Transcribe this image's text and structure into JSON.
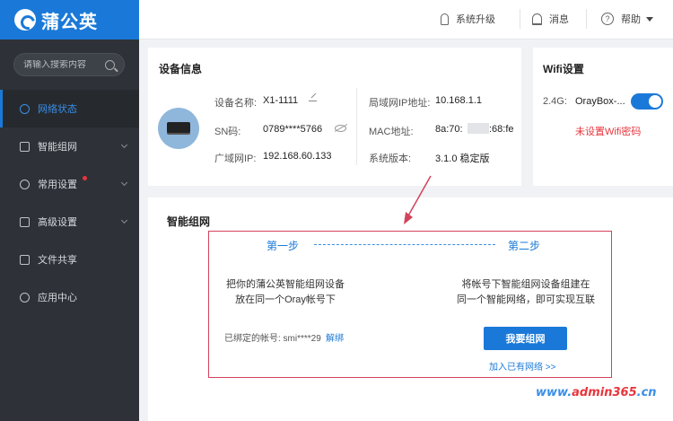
{
  "app": {
    "name": "蒲公英"
  },
  "search": {
    "placeholder": "请输入搜索内容"
  },
  "sidebar": {
    "items": [
      {
        "label": "网络状态",
        "active": true
      },
      {
        "label": "智能组网",
        "has_submenu": true
      },
      {
        "label": "常用设置",
        "has_submenu": true,
        "badge": "red-dot"
      },
      {
        "label": "高级设置",
        "has_submenu": true
      },
      {
        "label": "文件共享"
      },
      {
        "label": "应用中心"
      }
    ]
  },
  "header": {
    "upgrade_label": "系统升级",
    "messages_label": "消息",
    "help_label": "帮助"
  },
  "device_info": {
    "title": "设备信息",
    "name_label": "设备名称:",
    "name_value": "X1-1111",
    "sn_label": "SN码:",
    "sn_value": "0789****5766",
    "wan_ip_label": "广域网IP:",
    "wan_ip_value": "192.168.60.133",
    "lan_ip_label": "局域网IP地址:",
    "lan_ip_value": "10.168.1.1",
    "mac_label": "MAC地址:",
    "mac_prefix": "8a:70:",
    "mac_suffix": ":68:fe",
    "version_label": "系统版本:",
    "version_value": "3.1.0 稳定版"
  },
  "wifi": {
    "title": "Wifi设置",
    "band": "2.4G:",
    "ssid": "OrayBox-...",
    "enabled": true,
    "warning": "未设置Wifi密码",
    "warning_color": "#e8353c"
  },
  "smart_network": {
    "title": "智能组网",
    "step1_label": "第一步",
    "step2_label": "第二步",
    "step1_line1": "把你的蒲公英智能组网设备",
    "step1_line2": "放在同一个Oray帐号下",
    "step2_line1": "将帐号下智能组网设备组建在",
    "step2_line2": "同一个智能网络，即可实现互联",
    "bound_account_label": "已绑定的帐号: smi****29",
    "unbind_link": "解绑",
    "join_button": "我要组网",
    "join_existing_link": "加入已有网络 >>"
  },
  "watermark": {
    "prefix": "www.",
    "brand": "admin365",
    "suffix": ".cn"
  },
  "colors": {
    "brand": "#1a79d8",
    "sidebar": "#2e3238",
    "highlight": "#d2425b"
  }
}
